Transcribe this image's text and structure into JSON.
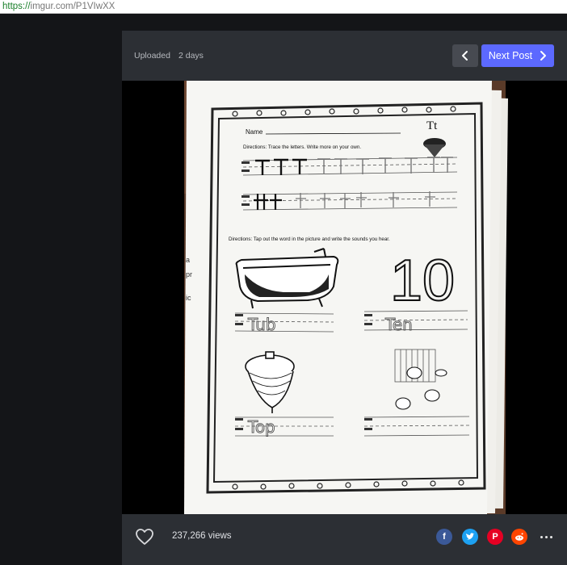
{
  "browser": {
    "url_scheme": "https://",
    "url_rest": "imgur.com/P1VIwXX"
  },
  "post": {
    "uploaded_label": "Uploaded",
    "uploaded_time": "2 days",
    "next_label": "Next Post",
    "views_text": "237,266 views"
  },
  "worksheet": {
    "name_label": "Name",
    "letter_title": "Tt",
    "directions_trace": "Directions: Trace the letters. Write more on your own.",
    "directions_tap": "Directions: Tap out the word in the picture and write the sounds you hear.",
    "number_picture": "10",
    "answers": {
      "tub": "Tub",
      "ten": "Ten",
      "top": "Top"
    }
  },
  "icons": {
    "prev": "chevron-left-icon",
    "next": "chevron-right-icon",
    "like": "heart-icon",
    "facebook": "facebook-icon",
    "twitter": "twitter-icon",
    "pinterest": "pinterest-icon",
    "reddit": "reddit-icon",
    "more": "ellipsis-icon"
  },
  "colors": {
    "accent": "#5c69ff",
    "panel": "#2c2f34",
    "background": "#141518"
  }
}
